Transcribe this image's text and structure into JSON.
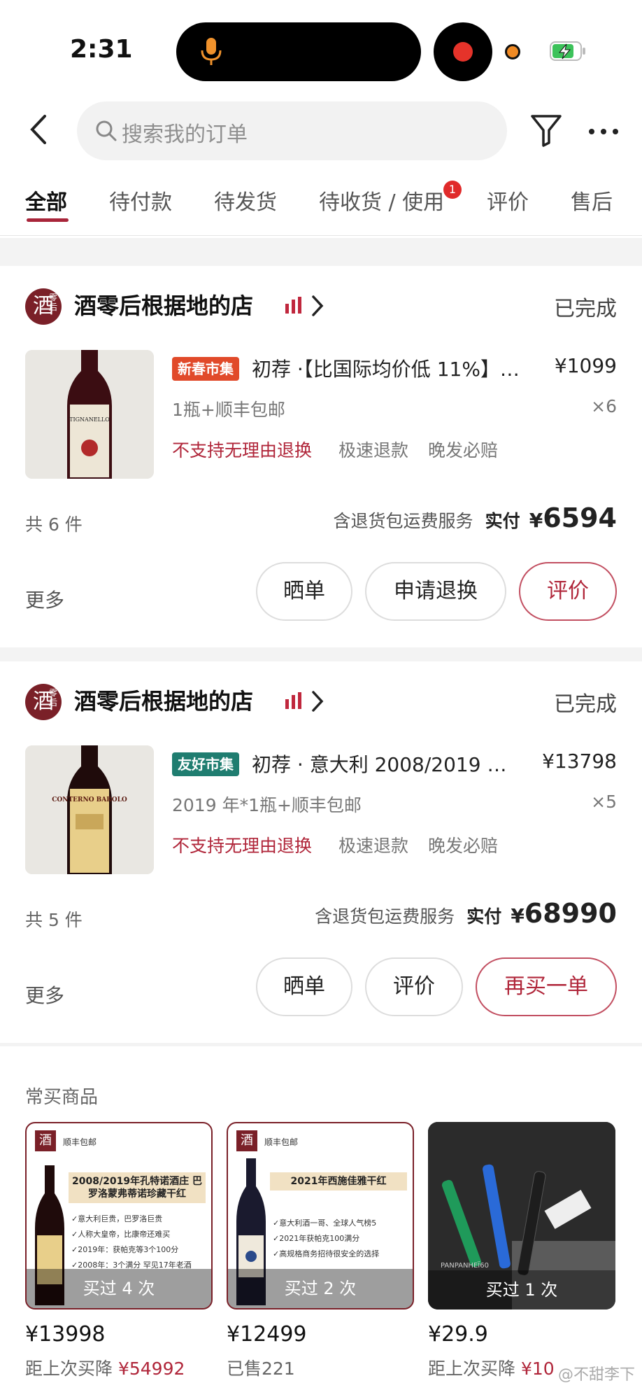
{
  "status_bar": {
    "time": "2:31"
  },
  "search": {
    "placeholder": "搜索我的订单"
  },
  "tabs": [
    {
      "label": "全部",
      "active": true
    },
    {
      "label": "待付款"
    },
    {
      "label": "待发货"
    },
    {
      "label": "待收货 / 使用",
      "badge": "1"
    },
    {
      "label": "评价"
    },
    {
      "label": "售后"
    }
  ],
  "orders": [
    {
      "shop_name": "酒零后根据地的店",
      "status": "已完成",
      "tag": "新春市集",
      "title": "初荐 ·【比国际均价低 11%】…",
      "price": "¥1099",
      "spec": "1瓶+顺丰包邮",
      "qty": "×6",
      "services": [
        "不支持无理由退换",
        "极速退款",
        "晚发必赔"
      ],
      "count": "共 6 件",
      "total_service": "含退货包运费服务",
      "paid_label": "实付",
      "paid_currency": "¥",
      "paid_amount": "6594",
      "more": "更多",
      "buttons": [
        "晒单",
        "申请退换",
        "评价"
      ],
      "bottle_label": "TIGNANELLO"
    },
    {
      "shop_name": "酒零后根据地的店",
      "status": "已完成",
      "tag": "友好市集",
      "title": "初荐 · 意大利 2008/2019 …",
      "price": "¥13798",
      "spec": "2019 年*1瓶+顺丰包邮",
      "qty": "×5",
      "services": [
        "不支持无理由退换",
        "极速退款",
        "晚发必赔"
      ],
      "count": "共 5 件",
      "total_service": "含退货包运费服务",
      "paid_label": "实付",
      "paid_currency": "¥",
      "paid_amount": "68990",
      "more": "更多",
      "buttons": [
        "晒单",
        "评价",
        "再买一单"
      ],
      "bottle_label": "CONTERNO BAROLO"
    }
  ],
  "frequent": {
    "title": "常买商品",
    "items": [
      {
        "bought": "买过 4 次",
        "price": "¥13998",
        "note_prefix": "距上次买降",
        "note_value": "¥54992",
        "img_header": "顺丰包邮",
        "img_banner": "2008/2019年孔特诺酒庄 巴罗洛蒙弗蒂诺珍藏干红",
        "img_bullets": [
          "✓意大利巨贵，巴罗洛巨贵",
          "✓人称大皇帝，比康帝还难买",
          "✓2019年：获帕克等3个100分",
          "✓2008年：3个满分  罕见17年老酒"
        ]
      },
      {
        "bought": "买过 2 次",
        "price": "¥12499",
        "note_prefix": "已售221",
        "note_value": "",
        "img_header": "顺丰包邮",
        "img_banner": "2021年西施佳雅干红",
        "img_bullets": [
          "✓意大利酒一哥、全球人气榜5",
          "✓2021年获帕克100满分",
          "✓高规格商务招待很安全的选择"
        ]
      },
      {
        "bought": "买过 1 次",
        "price": "¥29.9",
        "note_prefix": "距上次买降",
        "note_value": "¥10",
        "img_header": "",
        "img_banner": "",
        "img_bullets": [
          "PANPANHEÏ60"
        ]
      }
    ]
  },
  "watermark": "@不甜李下",
  "colors": {
    "accent": "#b0263a",
    "tag_red": "#e14a2a",
    "tag_green": "#1f7d70",
    "shop_logo": "#7a2028"
  }
}
